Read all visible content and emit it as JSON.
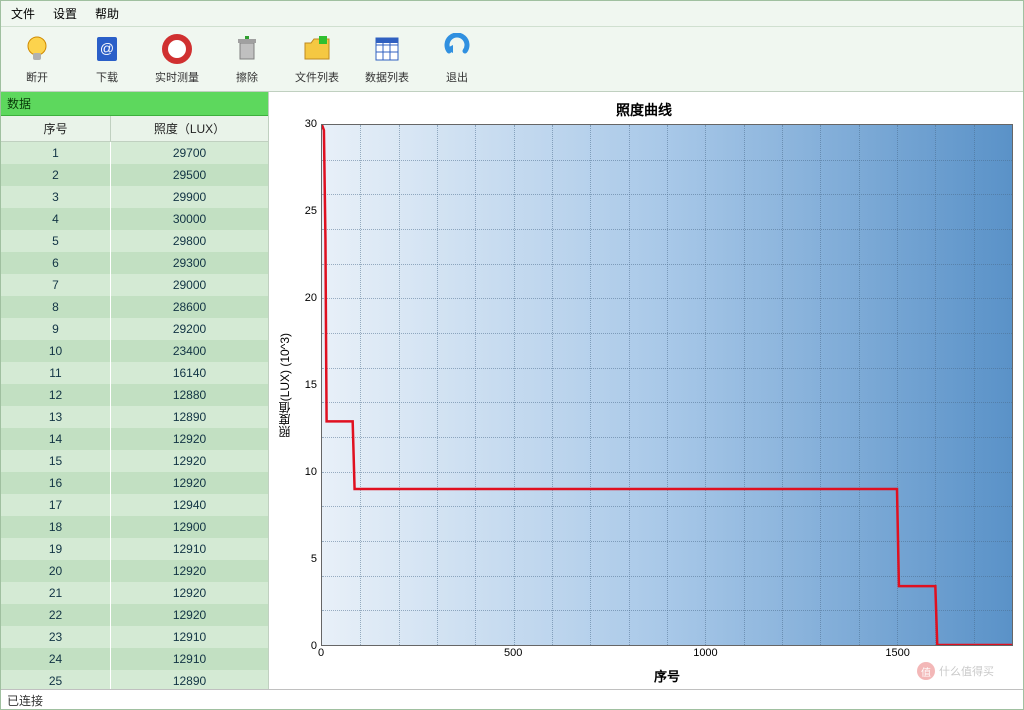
{
  "menu": {
    "file": "文件",
    "settings": "设置",
    "help": "帮助"
  },
  "toolbar": {
    "disconnect": "断开",
    "download": "下载",
    "realtime": "实时测量",
    "clear": "擦除",
    "filelist": "文件列表",
    "datalist": "数据列表",
    "exit": "退出"
  },
  "left": {
    "title": "数据",
    "col1": "序号",
    "col2": "照度（LUX）",
    "rows": [
      {
        "i": "1",
        "v": "29700"
      },
      {
        "i": "2",
        "v": "29500"
      },
      {
        "i": "3",
        "v": "29900"
      },
      {
        "i": "4",
        "v": "30000"
      },
      {
        "i": "5",
        "v": "29800"
      },
      {
        "i": "6",
        "v": "29300"
      },
      {
        "i": "7",
        "v": "29000"
      },
      {
        "i": "8",
        "v": "28600"
      },
      {
        "i": "9",
        "v": "29200"
      },
      {
        "i": "10",
        "v": "23400"
      },
      {
        "i": "11",
        "v": "16140"
      },
      {
        "i": "12",
        "v": "12880"
      },
      {
        "i": "13",
        "v": "12890"
      },
      {
        "i": "14",
        "v": "12920"
      },
      {
        "i": "15",
        "v": "12920"
      },
      {
        "i": "16",
        "v": "12920"
      },
      {
        "i": "17",
        "v": "12940"
      },
      {
        "i": "18",
        "v": "12900"
      },
      {
        "i": "19",
        "v": "12910"
      },
      {
        "i": "20",
        "v": "12920"
      },
      {
        "i": "21",
        "v": "12920"
      },
      {
        "i": "22",
        "v": "12920"
      },
      {
        "i": "23",
        "v": "12910"
      },
      {
        "i": "24",
        "v": "12910"
      },
      {
        "i": "25",
        "v": "12890"
      }
    ]
  },
  "status": "已连接",
  "watermark": {
    "mark": "值",
    "text": "什么值得买"
  },
  "chart_data": {
    "type": "line",
    "title": "照度曲线",
    "xlabel": "序号",
    "ylabel": "照度值(LUX) (10^3)",
    "xlim": [
      0,
      1800
    ],
    "ylim": [
      0,
      30
    ],
    "xticks": [
      0,
      500,
      1000,
      1500
    ],
    "yticks": [
      0,
      5,
      10,
      15,
      20,
      25,
      30
    ],
    "series": [
      {
        "name": "照度",
        "color": "#e01020",
        "points": [
          {
            "x": 0,
            "y": 30
          },
          {
            "x": 5,
            "y": 29.7
          },
          {
            "x": 9,
            "y": 23.4
          },
          {
            "x": 11,
            "y": 16.1
          },
          {
            "x": 12,
            "y": 12.9
          },
          {
            "x": 80,
            "y": 12.9
          },
          {
            "x": 85,
            "y": 9.0
          },
          {
            "x": 1500,
            "y": 9.0
          },
          {
            "x": 1505,
            "y": 3.4
          },
          {
            "x": 1600,
            "y": 3.4
          },
          {
            "x": 1605,
            "y": 0.0
          },
          {
            "x": 1800,
            "y": 0.0
          }
        ]
      }
    ]
  }
}
